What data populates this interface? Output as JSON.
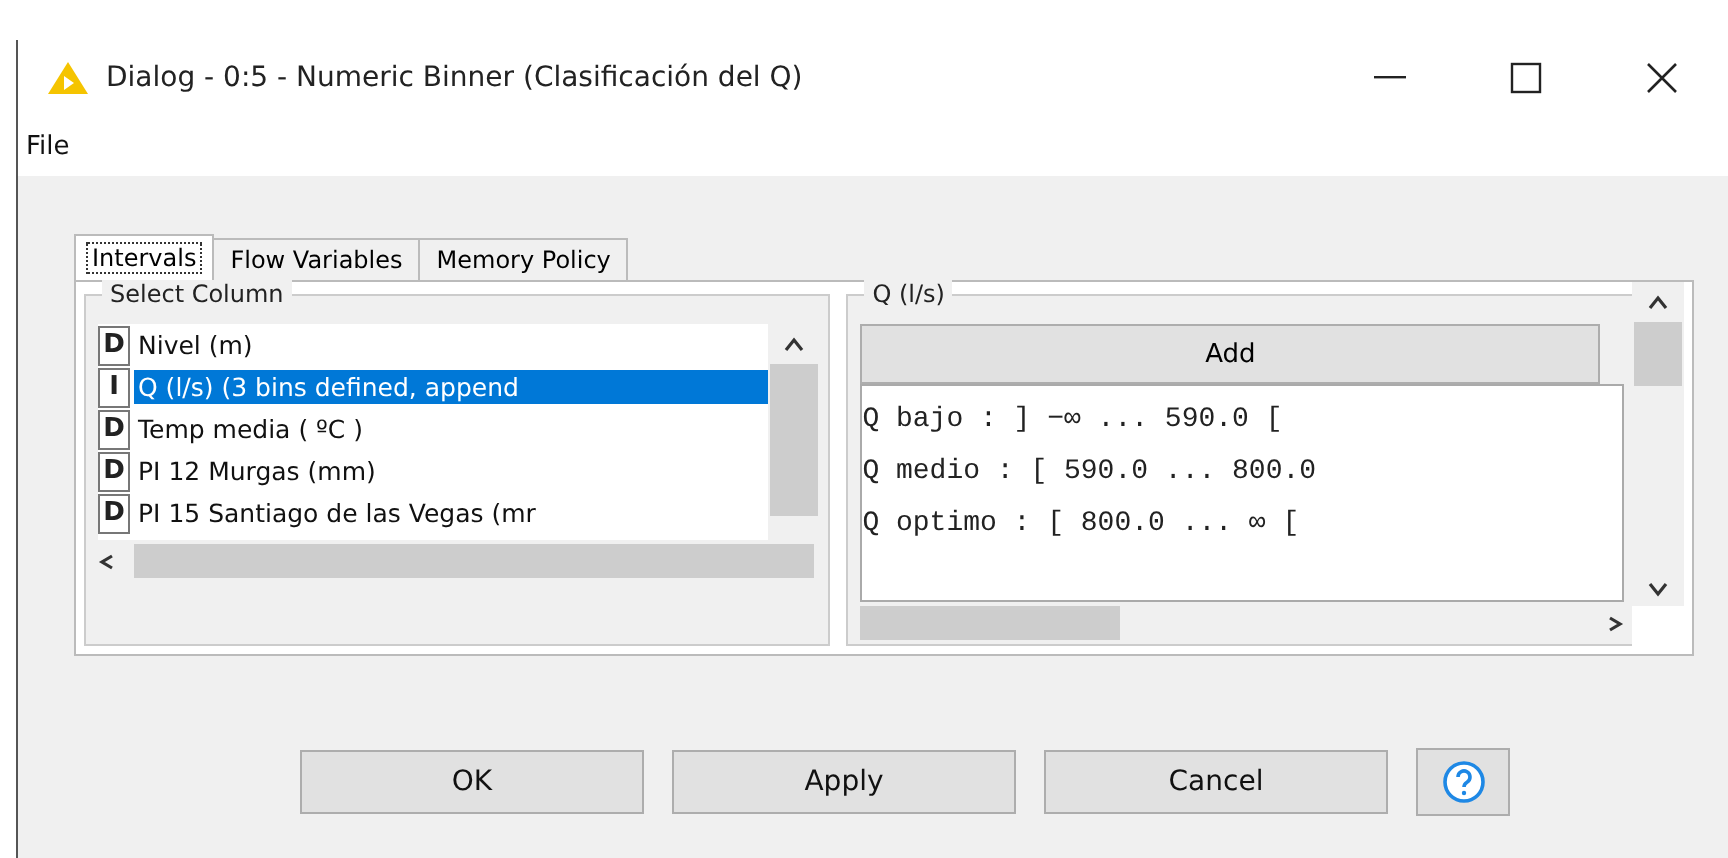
{
  "window": {
    "title": "Dialog - 0:5 - Numeric Binner (Clasificación del Q)"
  },
  "menu": [
    "File"
  ],
  "tabs": [
    {
      "label": "Intervals",
      "selected": true
    },
    {
      "label": "Flow Variables",
      "selected": false
    },
    {
      "label": "Memory Policy",
      "selected": false
    }
  ],
  "select_column": {
    "title": "Select Column",
    "items": [
      {
        "type": "D",
        "label": "Nivel (m)",
        "selected": false
      },
      {
        "type": "I",
        "label": "Q (l/s) (3 bins defined, append",
        "selected": true
      },
      {
        "type": "D",
        "label": "Temp media ( ºC )",
        "selected": false
      },
      {
        "type": "D",
        "label": "PI 12 Murgas (mm)",
        "selected": false
      },
      {
        "type": "D",
        "label": "PI 15 Santiago de las Vegas (mr",
        "selected": false
      }
    ]
  },
  "bins": {
    "title": "Q (l/s)",
    "add_button": "Add",
    "items": [
      "Q bajo : ] −∞ ... 590.0 [",
      "Q medio : [ 590.0 ... 800.0",
      "Q optimo : [ 800.0 ... ∞ ["
    ]
  },
  "buttons": [
    "OK",
    "Apply",
    "Cancel"
  ]
}
